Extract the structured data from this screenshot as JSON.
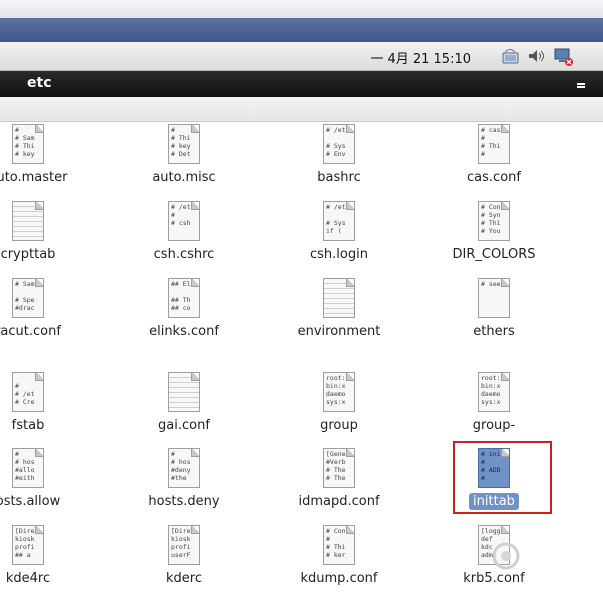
{
  "panel": {
    "clock": "一  4月 21 15:10",
    "tray_icons": [
      "network-icon",
      "volume-icon",
      "monitor-alert-icon"
    ]
  },
  "window": {
    "title": "etc"
  },
  "files": [
    {
      "name": "auto.master",
      "lines": [
        "#",
        "# Sam",
        "# Thi",
        "# key"
      ],
      "col": 0,
      "row": 0
    },
    {
      "name": "auto.misc",
      "lines": [
        "#",
        "# Thi",
        "# key",
        "# Det"
      ],
      "col": 1,
      "row": 0
    },
    {
      "name": "bashrc",
      "lines": [
        "# /et",
        "",
        "# Sys",
        "# Env"
      ],
      "col": 2,
      "row": 0
    },
    {
      "name": "cas.conf",
      "lines": [
        "# cas",
        "#",
        "# Thi",
        "#"
      ],
      "col": 3,
      "row": 0
    },
    {
      "name": "crypttab",
      "lines": [],
      "col": 0,
      "row": 1
    },
    {
      "name": "csh.cshrc",
      "lines": [
        "# /et",
        "#",
        "# csh",
        ""
      ],
      "col": 1,
      "row": 1
    },
    {
      "name": "csh.login",
      "lines": [
        "# /et",
        "",
        "# Sys",
        "if ("
      ],
      "col": 2,
      "row": 1
    },
    {
      "name": "DIR_COLORS",
      "lines": [
        "# Con",
        "# Syn",
        "# Thi",
        "# You"
      ],
      "col": 3,
      "row": 1
    },
    {
      "name": "racut.conf",
      "lines": [
        "# Sam",
        "",
        "# Spe",
        "#drac"
      ],
      "col": 0,
      "row": 2
    },
    {
      "name": "elinks.conf",
      "lines": [
        "## El",
        "",
        "## Th",
        "## co"
      ],
      "col": 1,
      "row": 2
    },
    {
      "name": "environment",
      "lines": [],
      "col": 2,
      "row": 2
    },
    {
      "name": "ethers",
      "lines": [
        "# see",
        "",
        "",
        ""
      ],
      "col": 3,
      "row": 2
    },
    {
      "name": "fstab",
      "lines": [
        "",
        "#",
        "# /et",
        "# Cre"
      ],
      "col": 0,
      "row": 3
    },
    {
      "name": "gai.conf",
      "lines": [],
      "col": 1,
      "row": 3
    },
    {
      "name": "group",
      "lines": [
        "root:",
        "bin:x",
        "daemo",
        "sys:x"
      ],
      "col": 2,
      "row": 3
    },
    {
      "name": "group-",
      "lines": [
        "root:",
        "bin:x",
        "daemo",
        "sys:x"
      ],
      "col": 3,
      "row": 3
    },
    {
      "name": "osts.allow",
      "lines": [
        "#",
        "# hos",
        "#allo",
        "#eith"
      ],
      "col": 0,
      "row": 4
    },
    {
      "name": "hosts.deny",
      "lines": [
        "#",
        "# hos",
        "#deny",
        "#the"
      ],
      "col": 1,
      "row": 4
    },
    {
      "name": "idmapd.conf",
      "lines": [
        "[Gene",
        "#Verb",
        "# The",
        "# The"
      ],
      "col": 2,
      "row": 4
    },
    {
      "name": "inittab",
      "lines": [
        "# ini",
        "#",
        "# ADD",
        "#"
      ],
      "col": 3,
      "row": 4,
      "selected": true
    },
    {
      "name": "kde4rc",
      "lines": [
        "[Dire",
        "kiosk",
        "profi",
        "## a"
      ],
      "col": 0,
      "row": 5
    },
    {
      "name": "kderc",
      "lines": [
        "[Dire",
        "kiosk",
        "profi",
        "userF"
      ],
      "col": 1,
      "row": 5
    },
    {
      "name": "kdump.conf",
      "lines": [
        "# Con",
        "#",
        "# Thi",
        "# ker"
      ],
      "col": 2,
      "row": 5
    },
    {
      "name": "krb5.conf",
      "lines": [
        "[logg",
        "def",
        "kdc",
        "admi"
      ],
      "col": 3,
      "row": 5
    }
  ]
}
